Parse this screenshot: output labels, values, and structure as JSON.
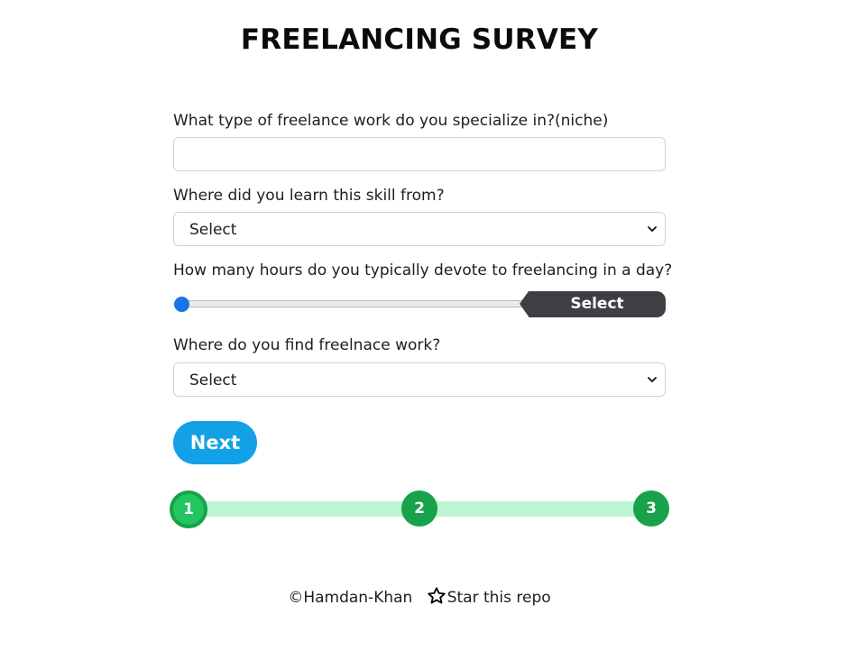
{
  "page": {
    "title": "FREELANCING SURVEY"
  },
  "form": {
    "q1": {
      "label": "What type of freelance work do you specialize in?(niche)",
      "value": "",
      "placeholder": ""
    },
    "q2": {
      "label": "Where did you learn this skill from?",
      "selected": "Select"
    },
    "q3": {
      "label": "How many hours do you typically devote to freelancing in a day?",
      "slider_value": 0,
      "bubble_text": "Select"
    },
    "q4": {
      "label": "Where do you find freelnace work?",
      "selected": "Select"
    },
    "next_label": "Next"
  },
  "progress": {
    "current_step": 1,
    "steps": [
      "1",
      "2",
      "3"
    ]
  },
  "footer": {
    "author": "©Hamdan-Khan",
    "star_label": "Star this repo"
  },
  "colors": {
    "accent": "#12a1e6",
    "slider_thumb": "#1a73e8",
    "step": "#18a24b",
    "step_active": "#22c55e",
    "progress_line": "#bdf5d2",
    "bubble": "#3e3f44"
  },
  "icons": {
    "select_chevron": "chevron-down-icon",
    "footer_star": "star-outline-icon"
  }
}
